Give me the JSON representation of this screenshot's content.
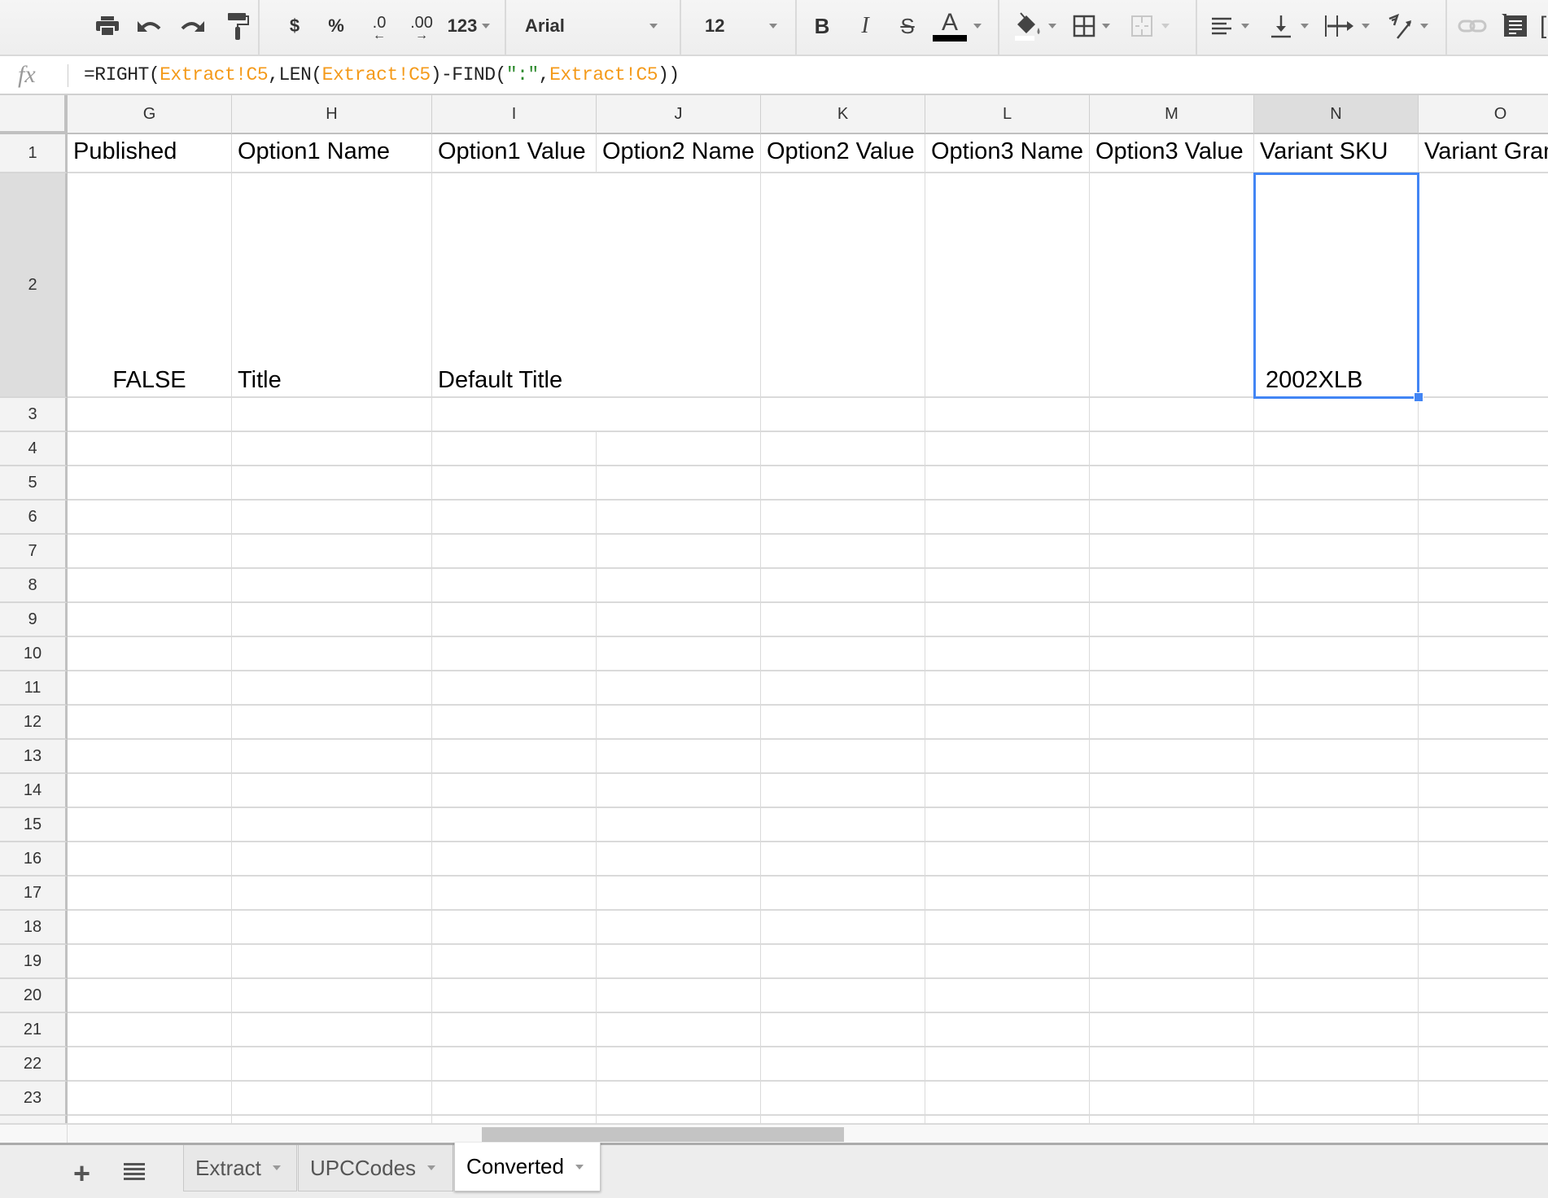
{
  "toolbar": {
    "print": "print-icon",
    "undo": "undo-icon",
    "redo": "redo-icon",
    "paint_format": "paint-format-icon",
    "currency_label": "$",
    "percent_label": "%",
    "decrease_decimal_label": ".0",
    "increase_decimal_label": ".00",
    "more_formats_label": "123",
    "font_family": "Arial",
    "font_size": "12",
    "bold_label": "B",
    "italic_label": "I",
    "strikethrough_label": "S",
    "text_color_label": "A",
    "text_color": "#000000",
    "fill_color": "#ffffff"
  },
  "formula_bar": {
    "fx_label": "fx",
    "formula_parts": [
      {
        "t": "=RIGHT(",
        "k": "plain"
      },
      {
        "t": "Extract!C5",
        "k": "ref"
      },
      {
        "t": ",LEN(",
        "k": "plain"
      },
      {
        "t": "Extract!C5",
        "k": "ref"
      },
      {
        "t": ")-FIND(",
        "k": "plain"
      },
      {
        "t": "\":\"",
        "k": "str"
      },
      {
        "t": ",",
        "k": "plain"
      },
      {
        "t": "Extract!C5",
        "k": "ref"
      },
      {
        "t": "))",
        "k": "plain"
      }
    ],
    "formula": "=RIGHT(Extract!C5,LEN(Extract!C5)-FIND(\":\",Extract!C5))"
  },
  "sheet": {
    "columns": [
      "G",
      "H",
      "I",
      "J",
      "K",
      "L",
      "M",
      "N",
      "O"
    ],
    "selected_column": "N",
    "selected_row": 2,
    "row_numbers": [
      1,
      2,
      3,
      4,
      5,
      6,
      7,
      8,
      9,
      10,
      11,
      12,
      13,
      14,
      15,
      16,
      17,
      18,
      19,
      20,
      21,
      22,
      23
    ],
    "header_row": [
      "Published",
      "Option1 Name",
      "Option1 Value",
      "Option2 Name",
      "Option2 Value",
      "Option3 Name",
      "Option3 Value",
      "Variant SKU",
      "Variant Grams"
    ],
    "row2": [
      "FALSE",
      "Title",
      "Default Title",
      "",
      "",
      "",
      "",
      "2002XLB",
      ""
    ],
    "selected_cell": "N2",
    "selection_color": "#4285f4"
  },
  "tabs": {
    "add_sheet": "+",
    "all_sheets": "sheet-list-icon",
    "items": [
      {
        "label": "Extract",
        "active": false
      },
      {
        "label": "UPCCodes",
        "active": false
      },
      {
        "label": "Converted",
        "active": true
      }
    ]
  }
}
